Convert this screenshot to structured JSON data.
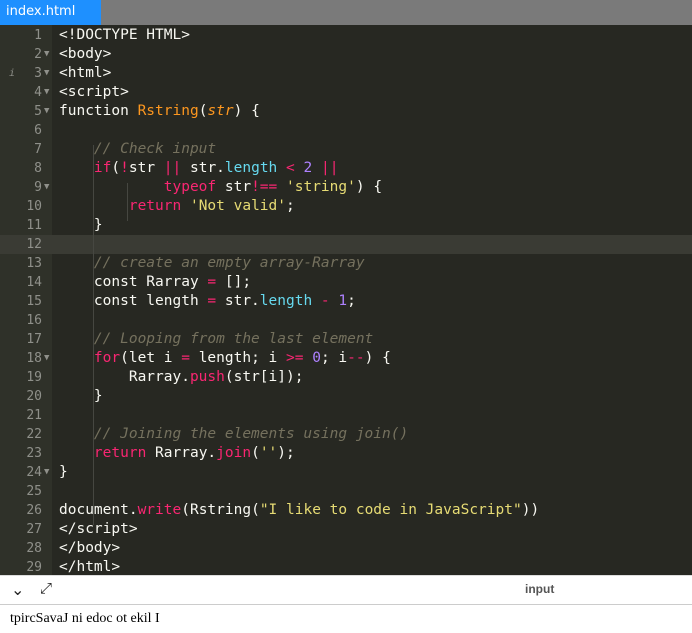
{
  "tab": {
    "filename": "index.html"
  },
  "editor": {
    "lines": [
      {
        "n": "1",
        "fold": false,
        "html": "&lt;!DOCTYPE HTML&gt;"
      },
      {
        "n": "2",
        "fold": true,
        "html": "&lt;body&gt;"
      },
      {
        "n": "3",
        "fold": true,
        "info": true,
        "html": "&lt;html&gt;"
      },
      {
        "n": "4",
        "fold": true,
        "html": "&lt;script&gt;"
      },
      {
        "n": "5",
        "fold": true,
        "html": "function <span class=\"f\">Rstring</span>(<span class=\"f\" style=\"font-style:italic\">str</span>) {"
      },
      {
        "n": "6",
        "fold": false,
        "html": ""
      },
      {
        "n": "7",
        "fold": false,
        "html": "    <span class=\"c\">// Check input</span>"
      },
      {
        "n": "8",
        "fold": false,
        "html": "    <span class=\"k\">if</span>(<span class=\"k\">!</span>str <span class=\"k\">||</span> str.<span class=\"p\">length</span> <span class=\"k\">&lt;</span> <span class=\"n\">2</span> <span class=\"k\">||</span>"
      },
      {
        "n": "9",
        "fold": true,
        "html": "            <span class=\"k\">typeof</span> str<span class=\"k\">!==</span> <span class=\"s\">'string'</span>) {"
      },
      {
        "n": "10",
        "fold": false,
        "html": "        <span class=\"k\">return</span> <span class=\"s\">'Not valid'</span>;"
      },
      {
        "n": "11",
        "fold": false,
        "html": "    }"
      },
      {
        "n": "12",
        "fold": false,
        "hl": true,
        "html": ""
      },
      {
        "n": "13",
        "fold": false,
        "html": "    <span class=\"c\">// create an empty array-Rarray</span>"
      },
      {
        "n": "14",
        "fold": false,
        "html": "    const Rarray <span class=\"k\">=</span> [];"
      },
      {
        "n": "15",
        "fold": false,
        "html": "    const length <span class=\"k\">=</span> str.<span class=\"p\">length</span> <span class=\"k\">-</span> <span class=\"n\">1</span>;"
      },
      {
        "n": "16",
        "fold": false,
        "html": ""
      },
      {
        "n": "17",
        "fold": false,
        "html": "    <span class=\"c\">// Looping from the last element</span>"
      },
      {
        "n": "18",
        "fold": true,
        "html": "    <span class=\"k\">for</span>(let i <span class=\"k\">=</span> length; i <span class=\"k\">&gt;=</span> <span class=\"n\">0</span>; i<span class=\"k\">--</span>) {"
      },
      {
        "n": "19",
        "fold": false,
        "html": "        Rarray.<span class=\"k\">push</span>(str[i]);"
      },
      {
        "n": "20",
        "fold": false,
        "html": "    }"
      },
      {
        "n": "21",
        "fold": false,
        "html": ""
      },
      {
        "n": "22",
        "fold": false,
        "html": "    <span class=\"c\">// Joining the elements using join()</span>"
      },
      {
        "n": "23",
        "fold": false,
        "html": "    <span class=\"k\">return</span> Rarray.<span class=\"k\">join</span>(<span class=\"s\">''</span>);"
      },
      {
        "n": "24",
        "fold": true,
        "html": "}"
      },
      {
        "n": "25",
        "fold": false,
        "html": ""
      },
      {
        "n": "26",
        "fold": false,
        "html": "document.<span class=\"k\">write</span>(Rstring(<span class=\"s\">\"I like to code in JavaScript\"</span>))"
      },
      {
        "n": "27",
        "fold": false,
        "html": "&lt;/script&gt;"
      },
      {
        "n": "28",
        "fold": false,
        "html": "&lt;/body&gt;"
      },
      {
        "n": "29",
        "fold": false,
        "html": "&lt;/html&gt;"
      }
    ]
  },
  "panel": {
    "collapse_icon": "chevron-down-icon",
    "expand_icon": "expand-arrows-icon",
    "label": "input"
  },
  "output": {
    "text": "tpircSavaJ ni edoc ot ekil I"
  }
}
